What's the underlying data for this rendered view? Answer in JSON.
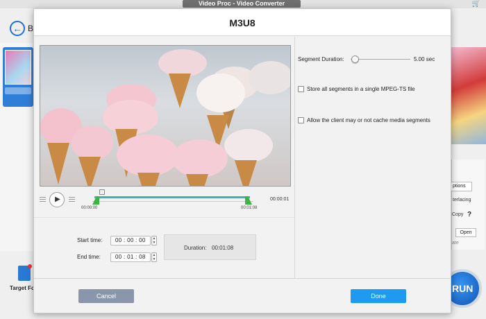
{
  "app": {
    "window_title": "Video Proc - Video Converter",
    "back_label": "B",
    "target_label": "Target For",
    "right_options_label": "ptions",
    "right_interlacing_label": "terlacing",
    "right_copy_label": "Copy",
    "right_help": "?",
    "right_open_label": "Open",
    "right_rate_label": "ate",
    "run_label": "RUN"
  },
  "dialog": {
    "title": "M3U8",
    "timeline": {
      "start_marker": "00:00:00",
      "end_marker": "00:01:08",
      "total_time": "00:00:01"
    },
    "start_time_label": "Start time:",
    "start_time": "00 : 00 : 00",
    "end_time_label": "End time:",
    "end_time": "00 : 01 : 08",
    "duration_label": "Duration:",
    "duration_value": "00:01:08",
    "segment_duration_label": "Segment Duration:",
    "segment_duration_value": "5.00 sec",
    "segment_duration_level": 0.05,
    "option_single_file": "Store all segments in a single MPEG-TS file",
    "option_cache": "Allow the client may or not cache media segments",
    "cancel_label": "Cancel",
    "done_label": "Done"
  },
  "colors": {
    "accent": "#1e9bf0",
    "cancel": "#8a97aa",
    "track": "#36b6b0",
    "handle": "#3cb443"
  }
}
